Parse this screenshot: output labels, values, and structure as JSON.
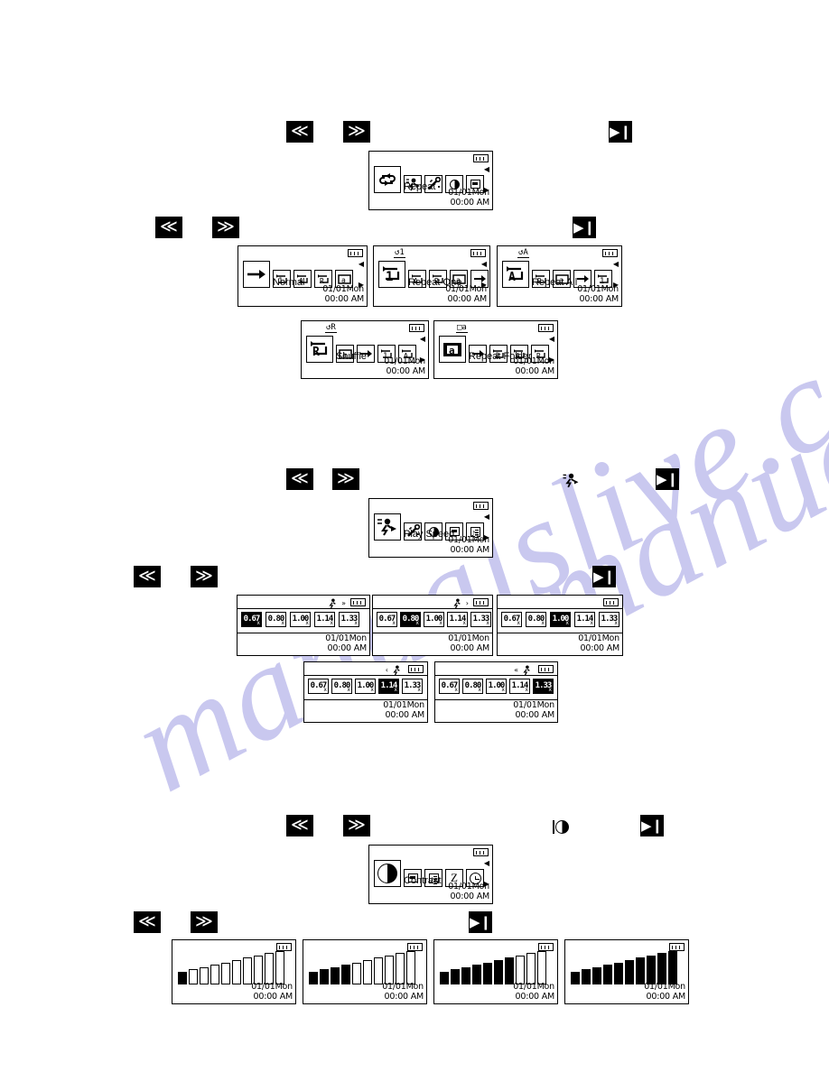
{
  "document": {
    "watermark_left": "manualslive.com",
    "watermark_right": "manualslive.com"
  },
  "nav": {
    "rewind_label": "≪",
    "forward_label": "≫",
    "playpause_label": "▶❙"
  },
  "common": {
    "battery_icon": "battery-icon",
    "date": "01/01Mon",
    "time": "00:00 AM",
    "arrow_up": "◀",
    "arrow_down": "▶"
  },
  "sections": [
    {
      "id": "repeat",
      "menu_screen": {
        "label": "Repeat",
        "selected_icon": "repeat-loop-icon",
        "icons": [
          "repeat-loop-icon",
          "play-speed-icon",
          "magic-wand-icon",
          "contrast-icon",
          "monitor-icon"
        ]
      },
      "option_screens": [
        {
          "label": "Normal",
          "title_glyph": "",
          "selected_icon": "arrow-right-icon",
          "icons": [
            "arrow-right-icon",
            "repeat-one-icon",
            "repeat-all-icon",
            "shuffle-icon",
            "repeat-folder-icon"
          ]
        },
        {
          "label": "Repeat One",
          "title_glyph": "↺1",
          "selected_icon": "repeat-one-icon",
          "icons": [
            "repeat-one-icon",
            "repeat-all-icon",
            "shuffle-icon",
            "repeat-folder-icon",
            "arrow-right-icon"
          ]
        },
        {
          "label": "Repeat All",
          "title_glyph": "↺A",
          "selected_icon": "repeat-all-icon",
          "icons": [
            "repeat-all-icon",
            "shuffle-icon",
            "repeat-folder-icon",
            "arrow-right-icon",
            "repeat-one-icon"
          ]
        },
        {
          "label": "Shuffle",
          "title_glyph": "↺R",
          "selected_icon": "shuffle-icon",
          "icons": [
            "shuffle-icon",
            "repeat-folder-icon",
            "arrow-right-icon",
            "repeat-one-icon",
            "repeat-all-icon"
          ]
        },
        {
          "label": "Repeat Folder",
          "title_glyph": "□a",
          "selected_icon": "repeat-folder-icon",
          "icons": [
            "repeat-folder-icon",
            "arrow-right-icon",
            "repeat-one-icon",
            "repeat-all-icon",
            "shuffle-icon"
          ]
        }
      ]
    },
    {
      "id": "play-speed",
      "standalone_icon": "play-speed-icon",
      "menu_screen": {
        "label": "Play Speed",
        "selected_icon": "play-speed-icon",
        "icons": [
          "play-speed-icon",
          "magic-wand-icon",
          "contrast-icon",
          "monitor-icon",
          "music-doc-icon"
        ]
      },
      "speed_values": [
        "0.67",
        "0.80",
        "1.00",
        "1.14",
        "1.33"
      ],
      "speed_unit": "x",
      "option_screens": [
        {
          "selected_index": 0,
          "head_icon": "runner-fast-right-icon",
          "head_mark": "»"
        },
        {
          "selected_index": 1,
          "head_icon": "runner-right-icon",
          "head_mark": "›"
        },
        {
          "selected_index": 2,
          "head_icon": "",
          "head_mark": ""
        },
        {
          "selected_index": 3,
          "head_icon": "runner-left-icon",
          "head_mark": "‹"
        },
        {
          "selected_index": 4,
          "head_icon": "runner-slow-left-icon",
          "head_mark": "«"
        }
      ]
    },
    {
      "id": "contrast",
      "standalone_icon": "contrast-icon",
      "menu_screen": {
        "label": "Contrast",
        "selected_icon": "contrast-icon",
        "icons": [
          "contrast-icon",
          "monitor-icon",
          "music-doc-icon",
          "sleep-z-icon",
          "clock-icon"
        ]
      },
      "bar_count": 10,
      "option_screens": [
        {
          "filled": 1
        },
        {
          "filled": 4
        },
        {
          "filled": 7
        },
        {
          "filled": 10
        }
      ]
    }
  ]
}
